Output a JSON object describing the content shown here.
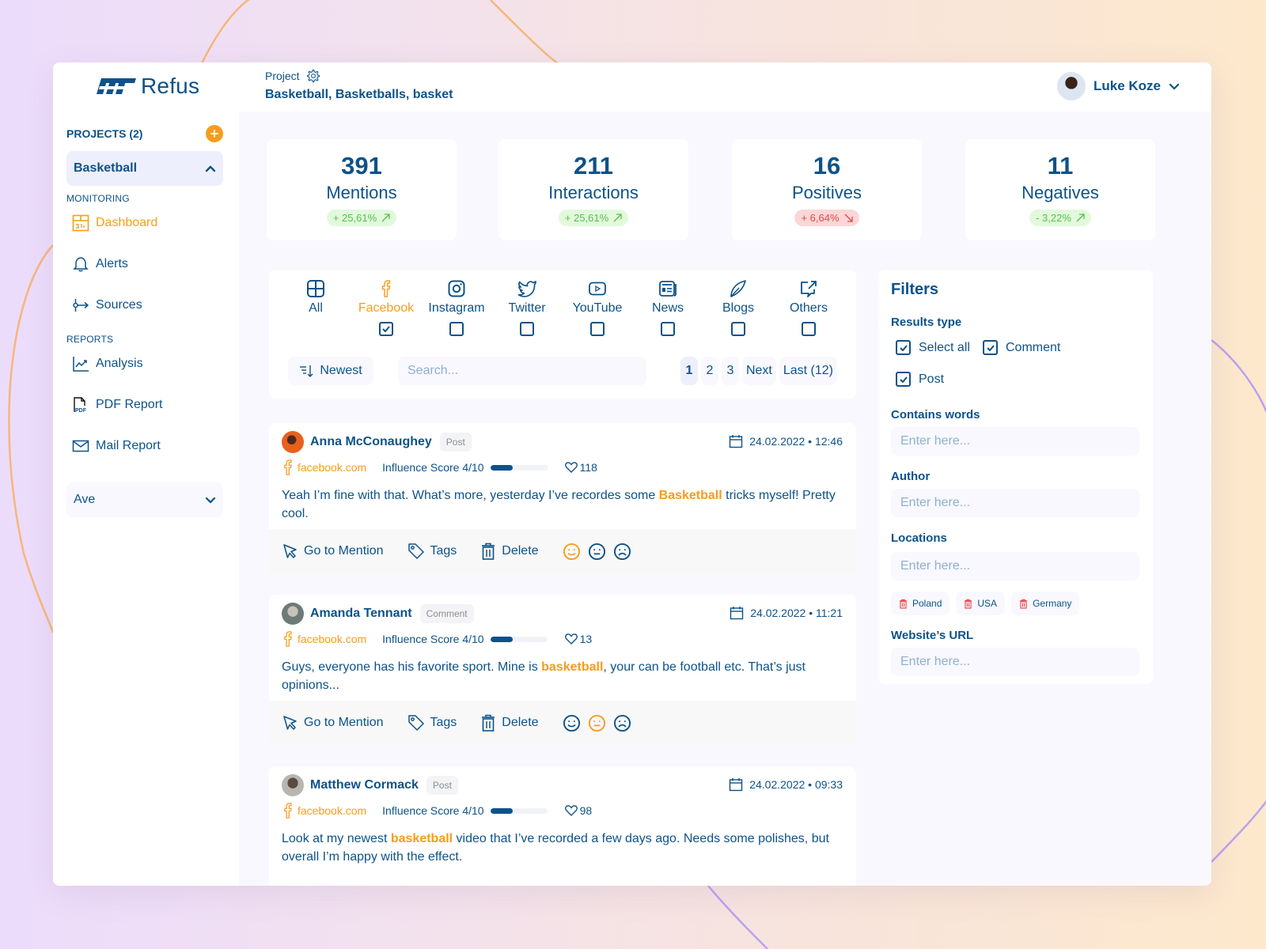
{
  "app": {
    "brand": "Refus",
    "project_label": "Project",
    "project_keywords": "Basketball, Basketballs, basket",
    "user_name": "Luke Koze",
    "colors": {
      "primary": "#0d5289",
      "accent": "#f89c1c",
      "positive": "#54c14a",
      "negative": "#e44747"
    }
  },
  "sidebar": {
    "projects_title": "PROJECTS (2)",
    "add_icon": "plus-icon",
    "current_project": "Basketball",
    "monitoring_label": "MONITORING",
    "monitoring_items": [
      {
        "label": "Dashboard",
        "icon": "dashboard-icon",
        "active": true
      },
      {
        "label": "Alerts",
        "icon": "bell-icon",
        "active": false
      },
      {
        "label": "Sources",
        "icon": "sources-icon",
        "active": false
      }
    ],
    "reports_label": "REPORTS",
    "report_items": [
      {
        "label": "Analysis",
        "icon": "chart-line-icon"
      },
      {
        "label": "PDF Report",
        "icon": "pdf-icon"
      },
      {
        "label": "Mail Report",
        "icon": "mail-icon"
      }
    ],
    "second_project": "Ave"
  },
  "stats": [
    {
      "value": "391",
      "label": "Mentions",
      "change": "+ 25,61%",
      "trend": "up",
      "direction_icon": "arrow-up-right-icon"
    },
    {
      "value": "211",
      "label": "Interactions",
      "change": "+ 25,61%",
      "trend": "up",
      "direction_icon": "arrow-up-right-icon"
    },
    {
      "value": "16",
      "label": "Positives",
      "change": "+ 6,64%",
      "trend": "down",
      "direction_icon": "arrow-down-right-icon"
    },
    {
      "value": "11",
      "label": "Negatives",
      "change": "- 3,22%",
      "trend": "up",
      "direction_icon": "arrow-up-right-icon"
    }
  ],
  "sources": [
    {
      "label": "All",
      "icon": "grid-icon",
      "checked": null
    },
    {
      "label": "Facebook",
      "icon": "facebook-icon",
      "checked": true,
      "active": true
    },
    {
      "label": "Instagram",
      "icon": "instagram-icon",
      "checked": false
    },
    {
      "label": "Twitter",
      "icon": "twitter-icon",
      "checked": false
    },
    {
      "label": "YouTube",
      "icon": "youtube-icon",
      "checked": false
    },
    {
      "label": "News",
      "icon": "news-icon",
      "checked": false
    },
    {
      "label": "Blogs",
      "icon": "blog-pen-icon",
      "checked": false
    },
    {
      "label": "Others",
      "icon": "external-link-icon",
      "checked": false
    }
  ],
  "toolbar": {
    "sort_label": "Newest",
    "search_placeholder": "Search...",
    "pages": [
      "1",
      "2",
      "3"
    ],
    "current_page": "1",
    "next_label": "Next",
    "last_label": "Last (12)"
  },
  "mentions": [
    {
      "author": "Anna McConaughey",
      "type": "Post",
      "date": "24.02.2022 • 12:46",
      "site": "facebook.com",
      "influence_label": "Influence Score 4/10",
      "influence": 0.4,
      "likes": "118",
      "text_before": "Yeah I’m fine with that. What’s more, yesterday I’ve recordes some ",
      "keyword": "Basketball",
      "text_after": " tricks myself! Pretty cool.",
      "sentiment": "positive"
    },
    {
      "author": "Amanda Tennant",
      "type": "Comment",
      "date": "24.02.2022 • 11:21",
      "site": "facebook.com",
      "influence_label": "Influence Score 4/10",
      "influence": 0.4,
      "likes": "13",
      "text_before": "Guys, everyone has his favorite sport. Mine is ",
      "keyword": "basketball",
      "text_after": ", your can be football etc. That’s just opinions...",
      "sentiment": "neutral"
    },
    {
      "author": "Matthew Cormack",
      "type": "Post",
      "date": "24.02.2022 • 09:33",
      "site": "facebook.com",
      "influence_label": "Influence Score 4/10",
      "influence": 0.4,
      "likes": "98",
      "text_before": "Look at my newest ",
      "keyword": "basketball",
      "text_after": " video that I’ve recorded a few days ago. Needs some polishes, but overall I’m happy with the effect.",
      "sentiment": null
    }
  ],
  "mention_actions": {
    "goto": "Go to Mention",
    "tags": "Tags",
    "delete": "Delete"
  },
  "filters": {
    "title": "Filters",
    "results_type_label": "Results type",
    "results_types": [
      {
        "label": "Select all",
        "checked": true
      },
      {
        "label": "Comment",
        "checked": true
      },
      {
        "label": "Post",
        "checked": true
      }
    ],
    "contains_words_label": "Contains words",
    "author_label": "Author",
    "locations_label": "Locations",
    "website_url_label": "Website’s URL",
    "input_placeholder": "Enter here...",
    "locations": [
      "Poland",
      "USA",
      "Germany"
    ]
  }
}
